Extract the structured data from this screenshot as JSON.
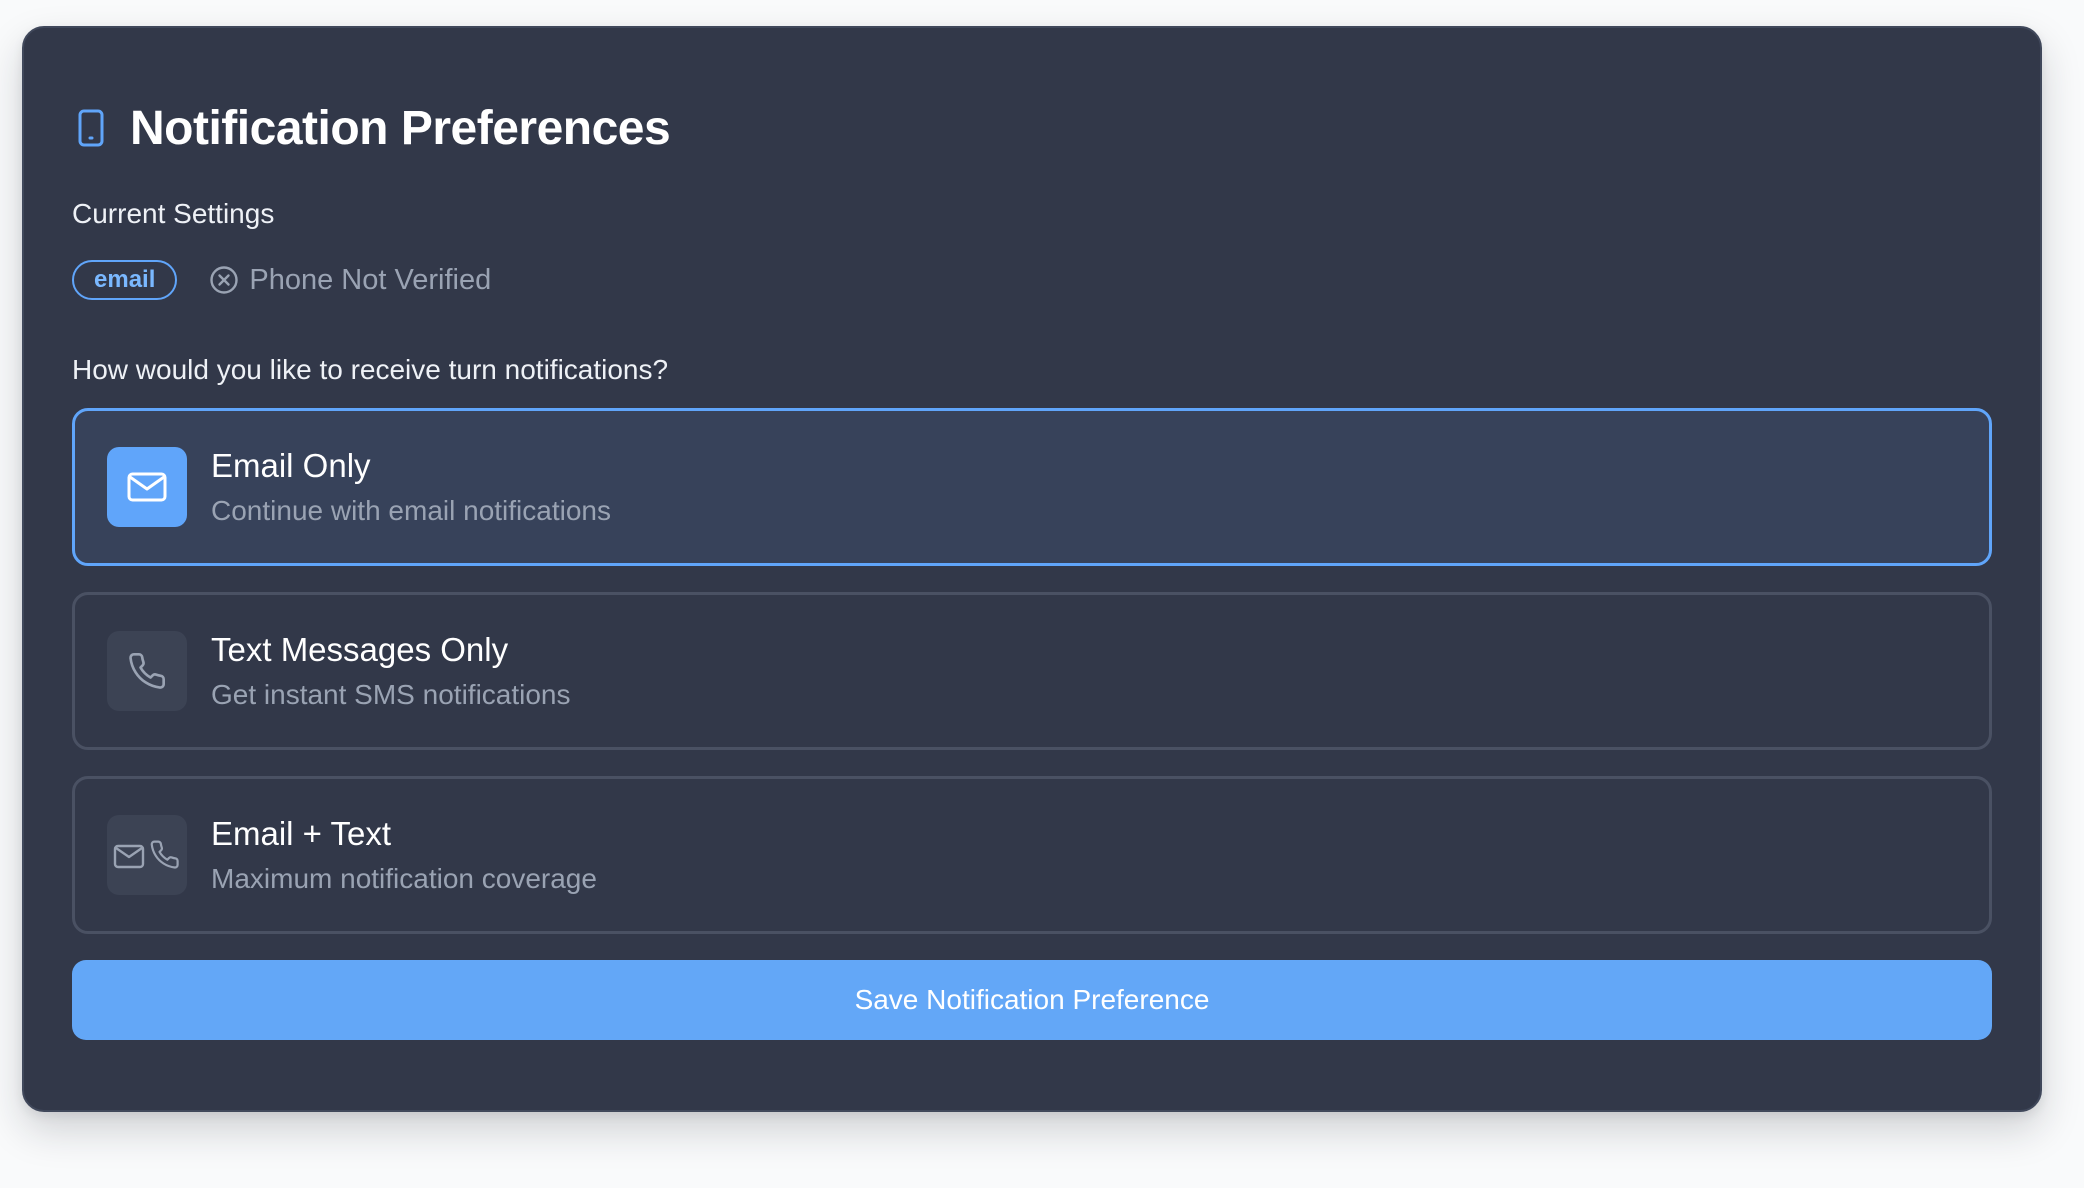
{
  "header": {
    "title": "Notification Preferences",
    "icon": "smartphone-icon"
  },
  "current_settings": {
    "label": "Current Settings",
    "badge": "email",
    "phone_status": "Phone Not Verified",
    "phone_status_icon": "x-circle-icon"
  },
  "question": "How would you like to receive turn notifications?",
  "options": [
    {
      "title": "Email Only",
      "description": "Continue with email notifications",
      "icon": "mail-icon",
      "selected": true
    },
    {
      "title": "Text Messages Only",
      "description": "Get instant SMS notifications",
      "icon": "phone-icon",
      "selected": false
    },
    {
      "title": "Email + Text",
      "description": "Maximum notification coverage",
      "icon": "mail-phone-icon",
      "selected": false
    }
  ],
  "save_button": {
    "label": "Save Notification Preference"
  },
  "colors": {
    "accent": "#60a5fa",
    "card_background": "#323849",
    "page_background": "#f9fafb"
  }
}
